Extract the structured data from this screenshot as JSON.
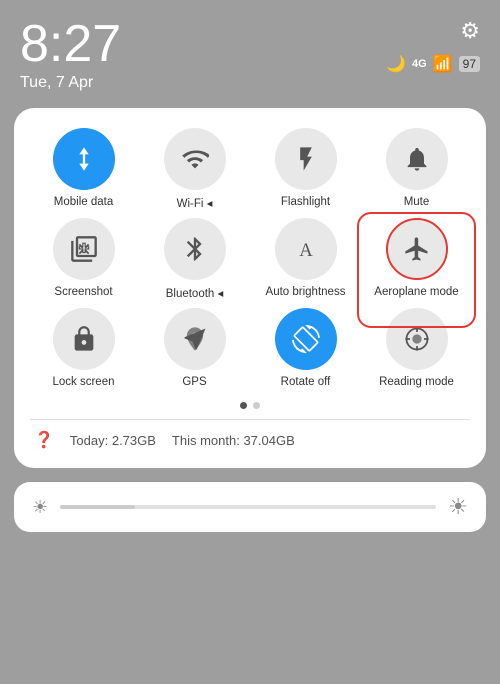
{
  "statusBar": {
    "time": "8:27",
    "date": "Tue, 7 Apr",
    "batteryLevel": "97",
    "gearLabel": "⚙"
  },
  "tiles": [
    {
      "id": "mobile-data",
      "label": "Mobile data",
      "active": true,
      "icon": "mobile-data"
    },
    {
      "id": "wifi",
      "label": "Wi-Fi ◂",
      "active": false,
      "icon": "wifi"
    },
    {
      "id": "flashlight",
      "label": "Flashlight",
      "active": false,
      "icon": "flashlight"
    },
    {
      "id": "mute",
      "label": "Mute",
      "active": false,
      "icon": "mute"
    },
    {
      "id": "screenshot",
      "label": "Screenshot",
      "active": false,
      "icon": "screenshot"
    },
    {
      "id": "bluetooth",
      "label": "Bluetooth ◂",
      "active": false,
      "icon": "bluetooth"
    },
    {
      "id": "auto-brightness",
      "label": "Auto brightness",
      "active": false,
      "icon": "auto-brightness"
    },
    {
      "id": "aeroplane-mode",
      "label": "Aeroplane mode",
      "active": false,
      "icon": "aeroplane",
      "highlight": true
    },
    {
      "id": "lock-screen",
      "label": "Lock screen",
      "active": false,
      "icon": "lock"
    },
    {
      "id": "gps",
      "label": "GPS",
      "active": false,
      "icon": "gps"
    },
    {
      "id": "rotate-off",
      "label": "Rotate off",
      "active": true,
      "icon": "rotate"
    },
    {
      "id": "reading-mode",
      "label": "Reading mode",
      "active": false,
      "icon": "reading"
    }
  ],
  "dots": [
    {
      "active": true
    },
    {
      "active": false
    }
  ],
  "dataUsage": {
    "today": "Today: 2.73GB",
    "month": "This month: 37.04GB"
  },
  "brightness": {
    "value": 20
  }
}
